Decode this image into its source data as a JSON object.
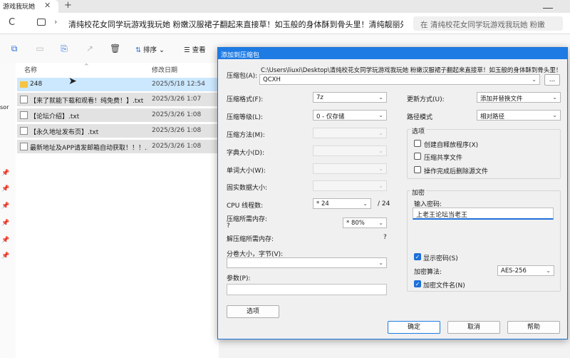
{
  "browser": {
    "tab_title": "游戏我玩她 ❙",
    "tab_close": "✕",
    "new_tab": "+",
    "reload": "C",
    "breadcrumb_sep": "›",
    "address": "清纯校花女同学玩游戏我玩她 粉嫩汉服裙子翻起来直接草！如玉般的身体酥到骨头里！清纯靓丽外表",
    "search_placeholder": "在 清纯校花女同学玩游戏我玩她 粉嫩"
  },
  "toolbar": {
    "sort_label": "排序",
    "view_label": "查看",
    "chevron": "⌄"
  },
  "file_list": {
    "col_name": "名称",
    "col_date": "修改日期",
    "rows": [
      {
        "name": "248",
        "date": "2025/5/18 12:54",
        "type": "folder"
      },
      {
        "name": "【来了就能下载和观看！纯免费！】.txt",
        "date": "2025/3/26 1:07",
        "type": "txt"
      },
      {
        "name": "【论坛介绍】.txt",
        "date": "2025/3/26 1:08",
        "type": "txt"
      },
      {
        "name": "【永久地址发布页】.txt",
        "date": "2025/3/26 1:08",
        "type": "txt"
      },
      {
        "name": "最新地址及APP请发邮箱自动获取！！！...",
        "date": "2025/3/26 1:08",
        "type": "txt"
      }
    ],
    "left_fragment": "sor"
  },
  "dialog": {
    "title": "添加到压缩包",
    "archive_label": "压缩包(A):",
    "archive_path": "C:\\Users\\liuxi\\Desktop\\清纯校花女同学玩游戏我玩她 粉嫩汉服裙子翻起来直接草！如玉般的身体酥到骨头里！",
    "archive_name": "QCXH",
    "browse_label": "...",
    "format_label": "压缩格式(F):",
    "format_value": "7z",
    "level_label": "压缩等级(L):",
    "level_value": "0 - 仅存储",
    "method_label": "压缩方法(M):",
    "dict_label": "字典大小(D):",
    "word_label": "单词大小(W):",
    "solid_label": "固实数据大小:",
    "cpu_label": "CPU 线程数:",
    "cpu_value": "* 24",
    "cpu_total": "/ 24",
    "mem_comp_label": "压缩所需内存:",
    "mem_comp_value": "?",
    "mem_pct": "* 80%",
    "mem_decomp_label": "解压缩所需内存:",
    "mem_decomp_value": "?",
    "split_label": "分卷大小，字节(V):",
    "params_label": "参数(P):",
    "options_btn": "选项",
    "update_label": "更新方式(U):",
    "update_value": "添加并替换文件",
    "path_label": "路径模式",
    "path_value": "相对路径",
    "options_group": "选项",
    "opt_sfx": "创建自释放程序(X)",
    "opt_shared": "压缩共享文件",
    "opt_delete": "操作完成后删除源文件",
    "encrypt_group": "加密",
    "password_label": "输入密码:",
    "password_value": "上老王论坛当老王",
    "show_password": "显示密码(S)",
    "enc_method_label": "加密算法:",
    "enc_method_value": "AES-256",
    "encrypt_names": "加密文件名(N)",
    "ok": "确定",
    "cancel": "取消",
    "help": "帮助",
    "check_mark": "✓"
  }
}
